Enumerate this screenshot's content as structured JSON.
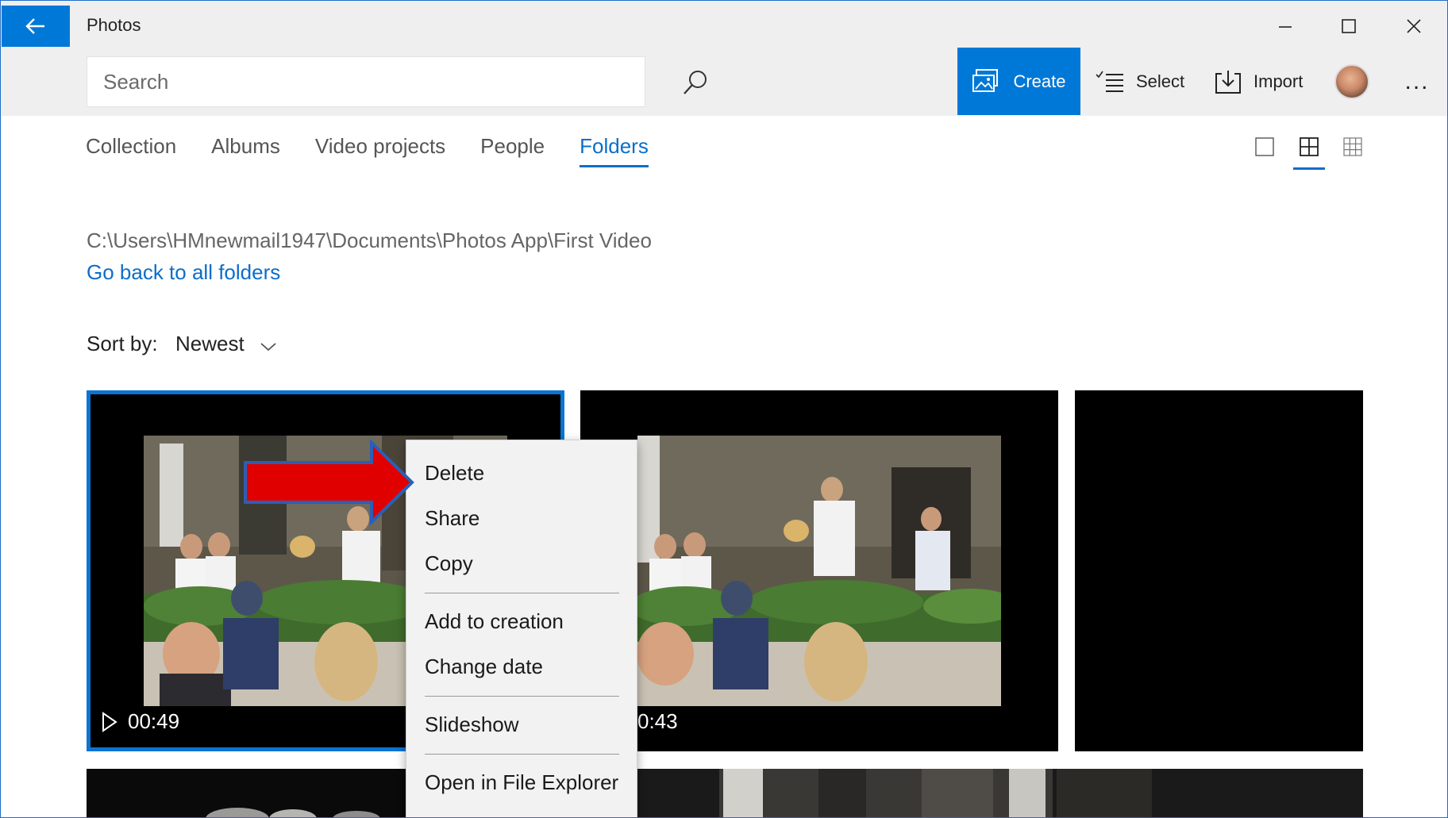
{
  "window": {
    "title": "Photos"
  },
  "search": {
    "placeholder": "Search"
  },
  "toolbar": {
    "create_label": "Create",
    "select_label": "Select",
    "import_label": "Import",
    "more_label": "..."
  },
  "tabs": [
    {
      "label": "Collection",
      "active": false
    },
    {
      "label": "Albums",
      "active": false
    },
    {
      "label": "Video projects",
      "active": false
    },
    {
      "label": "People",
      "active": false
    },
    {
      "label": "Folders",
      "active": true
    }
  ],
  "view_modes": [
    "single",
    "medium-grid",
    "small-grid"
  ],
  "active_view_mode": "medium-grid",
  "folder": {
    "path": "C:\\Users\\HMnewmail1947\\Documents\\Photos App\\First Video",
    "go_back_label": "Go back to all folders"
  },
  "sort": {
    "label": "Sort by:",
    "value": "Newest"
  },
  "tiles": [
    {
      "duration": "00:49",
      "selected": true
    },
    {
      "duration": "0:43",
      "selected": false
    },
    {
      "duration": "",
      "selected": false
    }
  ],
  "context_menu": {
    "items": [
      "Delete",
      "Share",
      "Copy",
      "Add to creation",
      "Change date",
      "Slideshow",
      "Open in File Explorer"
    ]
  },
  "colors": {
    "accent": "#0078d7",
    "link": "#0b6ec9",
    "annotation_arrow": "#e00000"
  }
}
